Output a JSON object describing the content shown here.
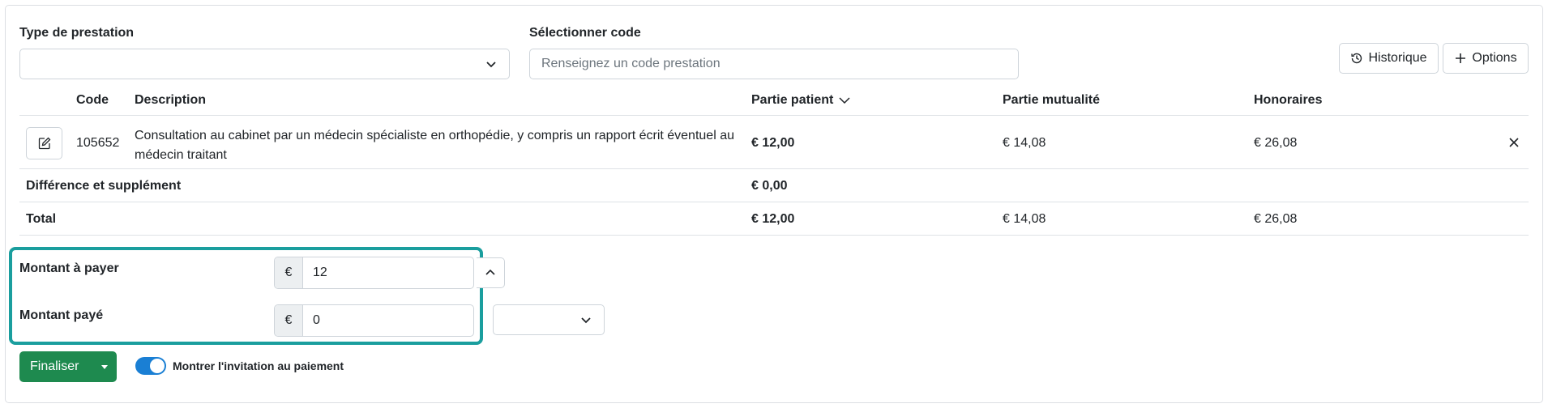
{
  "form": {
    "type_label": "Type de prestation",
    "type_value": "",
    "code_label": "Sélectionner code",
    "code_placeholder": "Renseignez un code prestation"
  },
  "actions": {
    "historique_label": "Historique",
    "options_label": "Options"
  },
  "table": {
    "headers": {
      "code": "Code",
      "description": "Description",
      "partie_patient": "Partie patient",
      "partie_mutualite": "Partie mutualité",
      "honoraires": "Honoraires"
    },
    "row": {
      "code": "105652",
      "description_line1": "Consultation au cabinet par un médecin spécialiste en orthopédie, y compris un rapport écrit éventuel au",
      "description_line2": "médecin traitant",
      "partie_patient": "€ 12,00",
      "partie_mutualite": "€ 14,08",
      "honoraires": "€ 26,08"
    },
    "difference": {
      "label": "Différence et supplément",
      "partie_patient": "€ 0,00"
    },
    "total": {
      "label": "Total",
      "partie_patient": "€ 12,00",
      "partie_mutualite": "€ 14,08",
      "honoraires": "€ 26,08"
    }
  },
  "payment": {
    "montant_a_payer_label": "Montant à payer",
    "montant_a_payer_currency": "€",
    "montant_a_payer_value": "12",
    "montant_paye_label": "Montant payé",
    "montant_paye_currency": "€",
    "montant_paye_value": "0",
    "method_value": ""
  },
  "footer": {
    "finaliser_label": "Finaliser",
    "toggle_label": "Montrer l'invitation au paiement",
    "toggle_on": true
  },
  "colors": {
    "highlight": "#1a9e9e",
    "primary_green": "#1e8a4f",
    "toggle_blue": "#1a7fd4"
  }
}
